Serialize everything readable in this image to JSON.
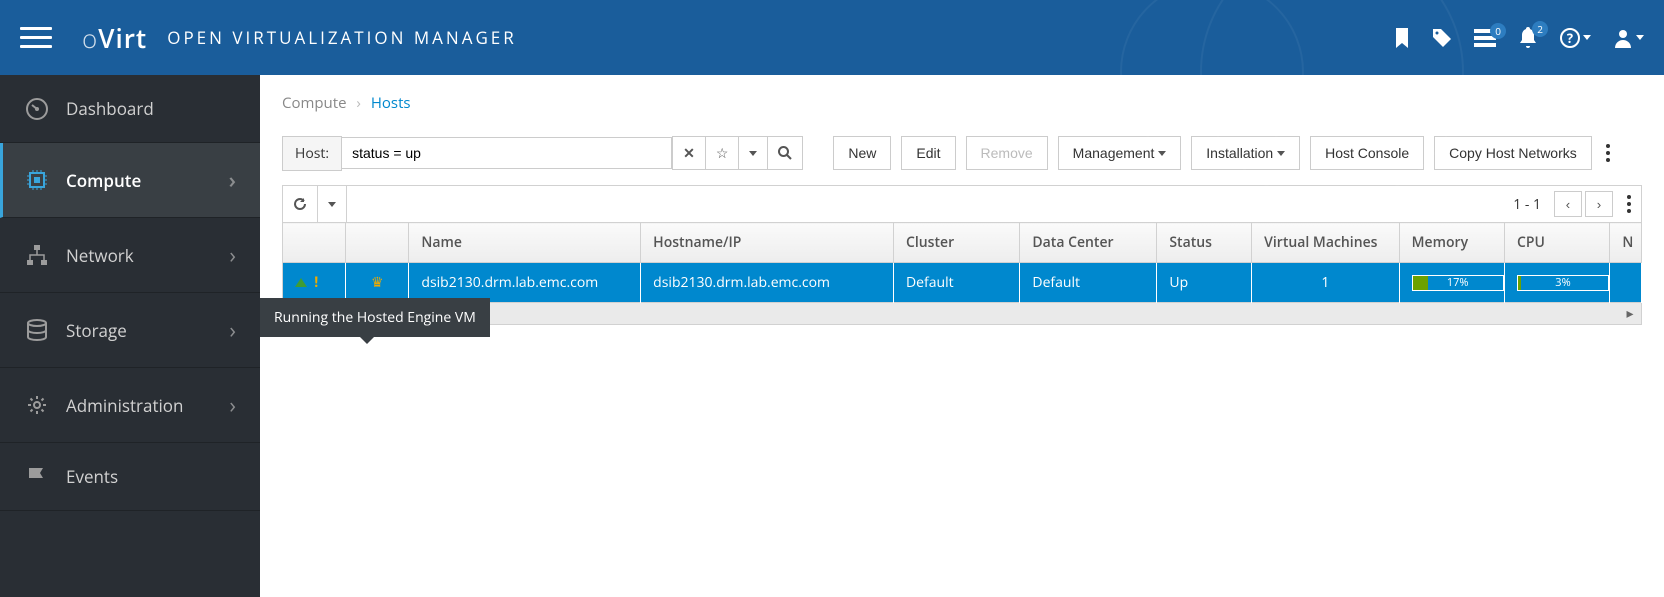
{
  "header": {
    "logo_html": "oVirt",
    "app_title": "OPEN VIRTUALIZATION MANAGER",
    "tasks_badge": "0",
    "alerts_badge": "2"
  },
  "sidebar": {
    "items": [
      {
        "label": "Dashboard",
        "icon": "dashboard",
        "expandable": false
      },
      {
        "label": "Compute",
        "icon": "compute",
        "expandable": true,
        "active": true
      },
      {
        "label": "Network",
        "icon": "network",
        "expandable": true
      },
      {
        "label": "Storage",
        "icon": "storage",
        "expandable": true
      },
      {
        "label": "Administration",
        "icon": "admin",
        "expandable": true
      },
      {
        "label": "Events",
        "icon": "events",
        "expandable": false
      }
    ]
  },
  "breadcrumb": {
    "root": "Compute",
    "current": "Hosts"
  },
  "toolbar": {
    "search_label": "Host:",
    "search_value": "status = up",
    "btn_new": "New",
    "btn_edit": "Edit",
    "btn_remove": "Remove",
    "btn_management": "Management",
    "btn_installation": "Installation",
    "btn_console": "Host Console",
    "btn_copy": "Copy Host Networks"
  },
  "table": {
    "page_info": "1 - 1",
    "columns": [
      "",
      "",
      "Name",
      "Hostname/IP",
      "Cluster",
      "Data Center",
      "Status",
      "Virtual Machines",
      "Memory",
      "CPU",
      "N"
    ],
    "rows": [
      {
        "status_icons": {
          "up": true,
          "warn": true,
          "hosted_engine": true
        },
        "name": "dsib2130.drm.lab.emc.com",
        "hostname": "dsib2130.drm.lab.emc.com",
        "cluster": "Default",
        "data_center": "Default",
        "status": "Up",
        "vms": "1",
        "memory_pct": "17%",
        "memory_val": 17,
        "cpu_pct": "3%",
        "cpu_val": 3
      }
    ]
  },
  "tooltip": "Running the Hosted Engine VM"
}
